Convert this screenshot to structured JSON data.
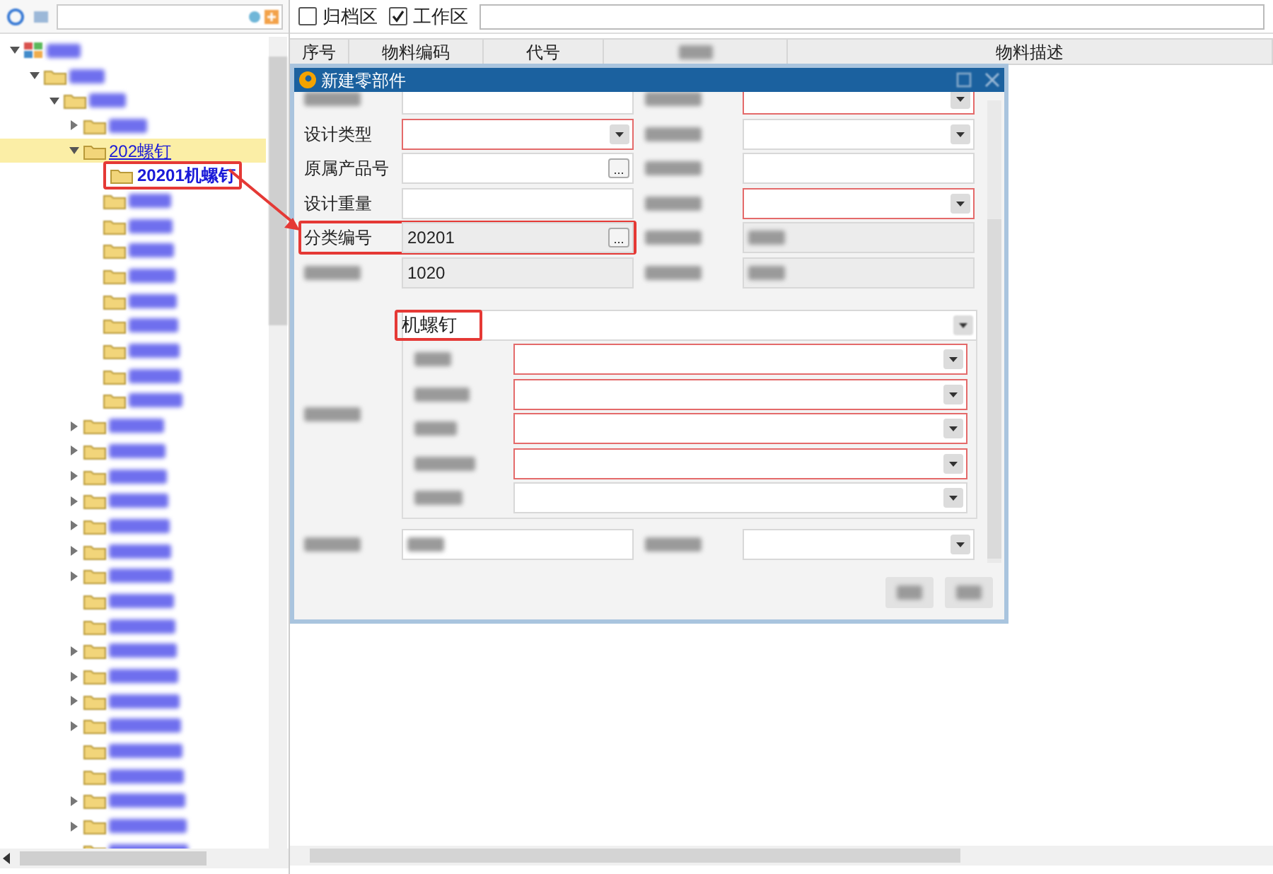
{
  "tree": {
    "items": [
      {
        "expanded": true,
        "selected": false,
        "children": [
          {
            "expanded": true,
            "selected": false,
            "children": [
              {
                "expanded": true,
                "selected": false,
                "children": [
                  {
                    "expanded": false,
                    "selected": false
                  },
                  {
                    "label": "202螺钉",
                    "expanded": true,
                    "selected": true,
                    "children": [
                      {
                        "label": "20201机螺钉",
                        "selected": false,
                        "highlighted": true
                      },
                      {
                        "selected": false
                      },
                      {
                        "selected": false
                      },
                      {
                        "selected": false
                      },
                      {
                        "selected": false
                      },
                      {
                        "selected": false
                      },
                      {
                        "selected": false
                      },
                      {
                        "selected": false
                      },
                      {
                        "selected": false
                      },
                      {
                        "selected": false
                      }
                    ]
                  },
                  {
                    "expanded": false,
                    "selected": false
                  },
                  {
                    "expanded": false,
                    "selected": false
                  },
                  {
                    "expanded": false,
                    "selected": false
                  },
                  {
                    "expanded": false,
                    "selected": false
                  },
                  {
                    "expanded": false,
                    "selected": false
                  },
                  {
                    "expanded": false,
                    "selected": false
                  },
                  {
                    "expanded": false,
                    "selected": false
                  },
                  {
                    "selected": false
                  },
                  {
                    "selected": false
                  },
                  {
                    "expanded": false,
                    "selected": false
                  },
                  {
                    "expanded": false,
                    "selected": false
                  },
                  {
                    "expanded": false,
                    "selected": false
                  },
                  {
                    "expanded": false,
                    "selected": false
                  },
                  {
                    "selected": false
                  },
                  {
                    "selected": false
                  },
                  {
                    "expanded": false,
                    "selected": false
                  },
                  {
                    "expanded": false,
                    "selected": false
                  },
                  {
                    "selected": false
                  }
                ]
              }
            ]
          }
        ]
      }
    ]
  },
  "filters": [
    {
      "label": "归档区",
      "checked": false
    },
    {
      "label": "工作区",
      "checked": true
    }
  ],
  "table": {
    "columns": [
      {
        "kind": "text",
        "label": "序号"
      },
      {
        "kind": "text",
        "label": "物料编码"
      },
      {
        "kind": "text",
        "label": "代号"
      },
      {
        "kind": "blurred"
      },
      {
        "kind": "text",
        "label": "物料描述"
      }
    ]
  },
  "dialog": {
    "title": "新建零部件",
    "rows": [
      {
        "left": {
          "kind": "text",
          "required": false,
          "readonly": false
        },
        "right": {
          "kind": "select",
          "required": true,
          "readonly": false
        }
      },
      {
        "left": {
          "label": "设计类型",
          "kind": "select",
          "required": true,
          "readonly": false
        },
        "right": {
          "kind": "select",
          "required": false,
          "readonly": false
        }
      },
      {
        "left": {
          "label": "原属产品号",
          "kind": "picker",
          "button": "...",
          "required": false,
          "readonly": false
        },
        "right": {
          "kind": "text",
          "required": false,
          "readonly": false
        }
      },
      {
        "left": {
          "label": "设计重量",
          "kind": "text",
          "required": false,
          "readonly": false
        },
        "right": {
          "kind": "select",
          "required": true,
          "readonly": false
        }
      },
      {
        "left": {
          "label": "分类编号",
          "kind": "picker",
          "button": "...",
          "value": "20201",
          "required": false,
          "readonly": true,
          "highlighted": true
        },
        "right": {
          "kind": "text",
          "required": false,
          "readonly": true,
          "obscured": true
        }
      },
      {
        "left": {
          "kind": "text",
          "value": "1020",
          "required": false,
          "readonly": true
        },
        "right": {
          "kind": "text",
          "required": false,
          "readonly": true,
          "obscured": true
        }
      }
    ],
    "feature": {
      "value": "机螺钉",
      "highlighted": true,
      "attributes": [
        {
          "required": true
        },
        {
          "required": true
        },
        {
          "required": true
        },
        {
          "required": true
        },
        {
          "required": false
        }
      ]
    },
    "bottom_row": {
      "left": {
        "kind": "text",
        "required": false,
        "readonly": false,
        "obscured": true
      },
      "right": {
        "kind": "select",
        "required": false,
        "readonly": false
      }
    }
  }
}
